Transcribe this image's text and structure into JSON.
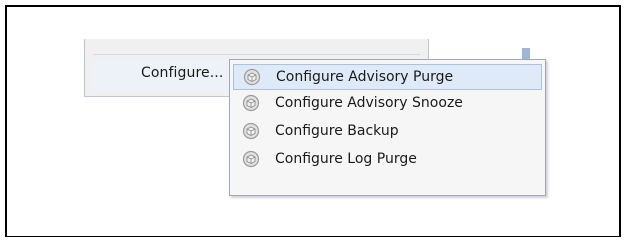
{
  "parent_menu": {
    "configure_label": "Configure..."
  },
  "submenu": {
    "items": [
      {
        "label": "Configure Advisory Purge",
        "icon": "gear-cube-icon",
        "active": true
      },
      {
        "label": "Configure Advisory Snooze",
        "icon": "gear-cube-icon",
        "active": false
      },
      {
        "label": "Configure Backup",
        "icon": "gear-cube-icon",
        "active": false
      },
      {
        "label": "Configure Log Purge",
        "icon": "gear-cube-icon",
        "active": false
      }
    ]
  },
  "colors": {
    "highlight": "#dfeaf8",
    "highlight_border": "#a9c1e3",
    "menu_background": "#f6f6f6"
  }
}
